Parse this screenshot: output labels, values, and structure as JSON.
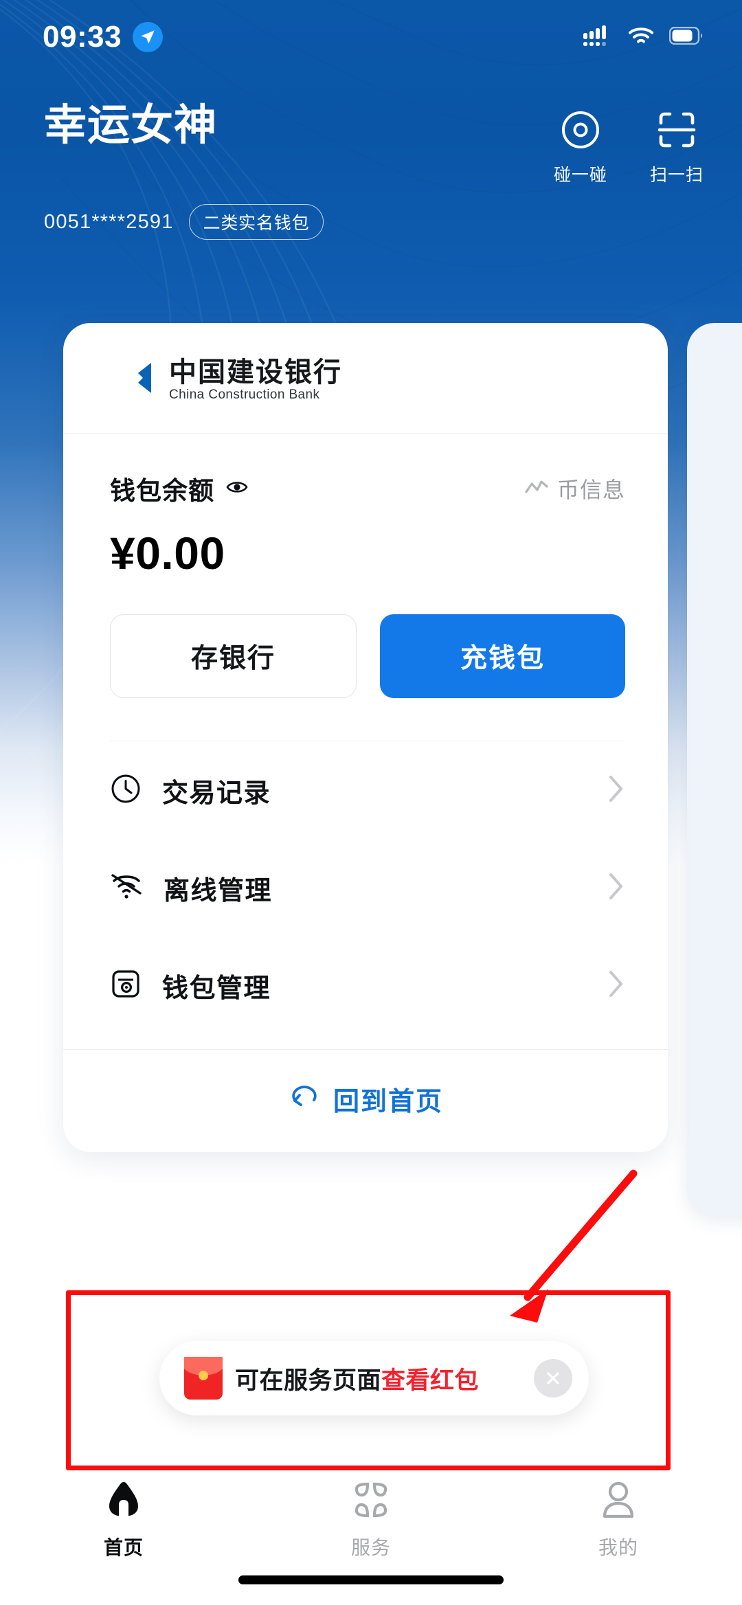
{
  "status_bar": {
    "time": "09:33",
    "location_icon": "location-arrow-icon",
    "signal_icon": "cellular-signal-icon",
    "wifi_icon": "wifi-icon",
    "battery_icon": "battery-icon"
  },
  "header": {
    "user_name": "幸运女神",
    "account_masked": "0051****2591",
    "account_badge": "二类实名钱包",
    "actions": [
      {
        "label": "碰一碰",
        "icon": "nfc-tap-icon"
      },
      {
        "label": "扫一扫",
        "icon": "scan-qr-icon"
      }
    ]
  },
  "card": {
    "bank_name_cn": "中国建设银行",
    "bank_name_en": "China Construction Bank",
    "bank_logo_icon": "ccb-logo-icon",
    "balance_label": "钱包余额",
    "eye_icon": "eye-visibility-icon",
    "currency_info_label": "币信息",
    "currency_info_icon": "line-chart-icon",
    "balance_amount": "¥0.00",
    "buttons": [
      {
        "label": "存银行",
        "style": "outline"
      },
      {
        "label": "充钱包",
        "style": "primary"
      }
    ],
    "menu_items": [
      {
        "label": "交易记录",
        "icon": "clock-icon"
      },
      {
        "label": "离线管理",
        "icon": "wifi-off-icon"
      },
      {
        "label": "钱包管理",
        "icon": "wallet-icon"
      }
    ],
    "home_link_label": "回到首页",
    "home_link_icon": "return-arrow-icon",
    "chevron_icon": "chevron-right-icon"
  },
  "toast": {
    "text_normal": "可在服务页面",
    "text_highlight": "查看红包",
    "envelope_icon": "red-envelope-icon",
    "close_icon": "close-icon"
  },
  "annotation": {
    "box_color": "#fb0d0d",
    "arrow_color": "#fb0d0d",
    "arrow_icon": "annotation-arrow-icon"
  },
  "tab_bar": {
    "tabs": [
      {
        "label": "首页",
        "icon": "home-icon",
        "active": true
      },
      {
        "label": "服务",
        "icon": "grid-services-icon",
        "active": false
      },
      {
        "label": "我的",
        "icon": "user-profile-icon",
        "active": false
      }
    ]
  },
  "colors": {
    "brand_blue": "#0b57a8",
    "accent_blue": "#1479e8",
    "link_blue": "#1273d4",
    "highlight_red": "#f5212d",
    "annotation_red": "#fb0d0d"
  }
}
